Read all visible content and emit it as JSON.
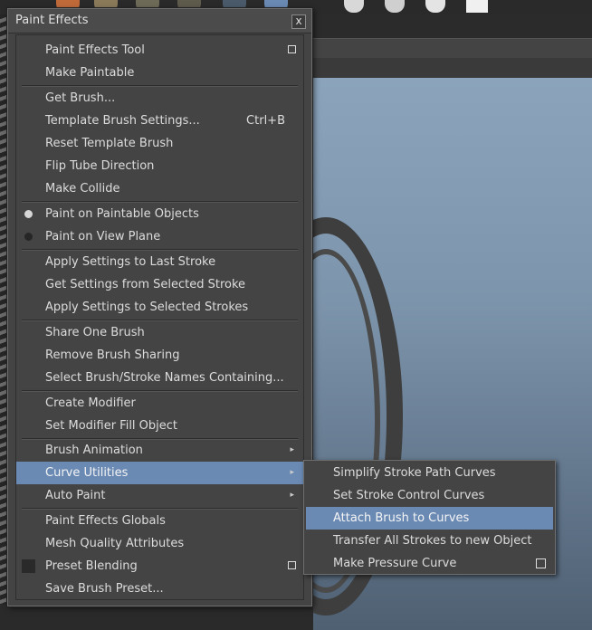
{
  "window": {
    "title": "Paint Effects",
    "close_glyph": "x"
  },
  "menu": {
    "items": [
      {
        "label": "Paint Effects Tool",
        "option_box": true
      },
      {
        "label": "Make Paintable"
      },
      {
        "label": "Get Brush..."
      },
      {
        "label": "Template Brush Settings...",
        "shortcut": "Ctrl+B"
      },
      {
        "label": "Reset Template Brush"
      },
      {
        "label": "Flip Tube Direction"
      },
      {
        "label": "Make Collide"
      },
      {
        "label": "Paint on Paintable Objects",
        "radio": "on"
      },
      {
        "label": "Paint on View Plane",
        "radio": "off"
      },
      {
        "label": "Apply Settings to Last Stroke"
      },
      {
        "label": "Get Settings from Selected Stroke"
      },
      {
        "label": "Apply Settings to Selected Strokes"
      },
      {
        "label": "Share One Brush"
      },
      {
        "label": "Remove Brush Sharing"
      },
      {
        "label": "Select Brush/Stroke Names Containing..."
      },
      {
        "label": "Create Modifier"
      },
      {
        "label": "Set Modifier Fill Object"
      },
      {
        "label": "Brush Animation",
        "submenu": true
      },
      {
        "label": "Curve Utilities",
        "submenu": true,
        "highlighted": true
      },
      {
        "label": "Auto Paint",
        "submenu": true
      },
      {
        "label": "Paint Effects Globals"
      },
      {
        "label": "Mesh Quality Attributes"
      },
      {
        "label": "Preset Blending",
        "checkbox": false,
        "option_box": true
      },
      {
        "label": "Save Brush Preset..."
      }
    ]
  },
  "submenu": {
    "parent": "Curve Utilities",
    "items": [
      {
        "label": "Simplify Stroke Path Curves"
      },
      {
        "label": "Set Stroke Control Curves"
      },
      {
        "label": "Attach Brush to Curves",
        "highlighted": true
      },
      {
        "label": "Transfer All Strokes to new Object"
      },
      {
        "label": "Make Pressure Curve",
        "option_box": true
      }
    ]
  },
  "icons": {
    "arrow": "▸",
    "option_box": "option-box-icon",
    "close": "close-icon"
  },
  "colors": {
    "highlight": "#6a8ab4",
    "menu_bg": "#444444",
    "viewport_sky": "#7d95ac"
  }
}
